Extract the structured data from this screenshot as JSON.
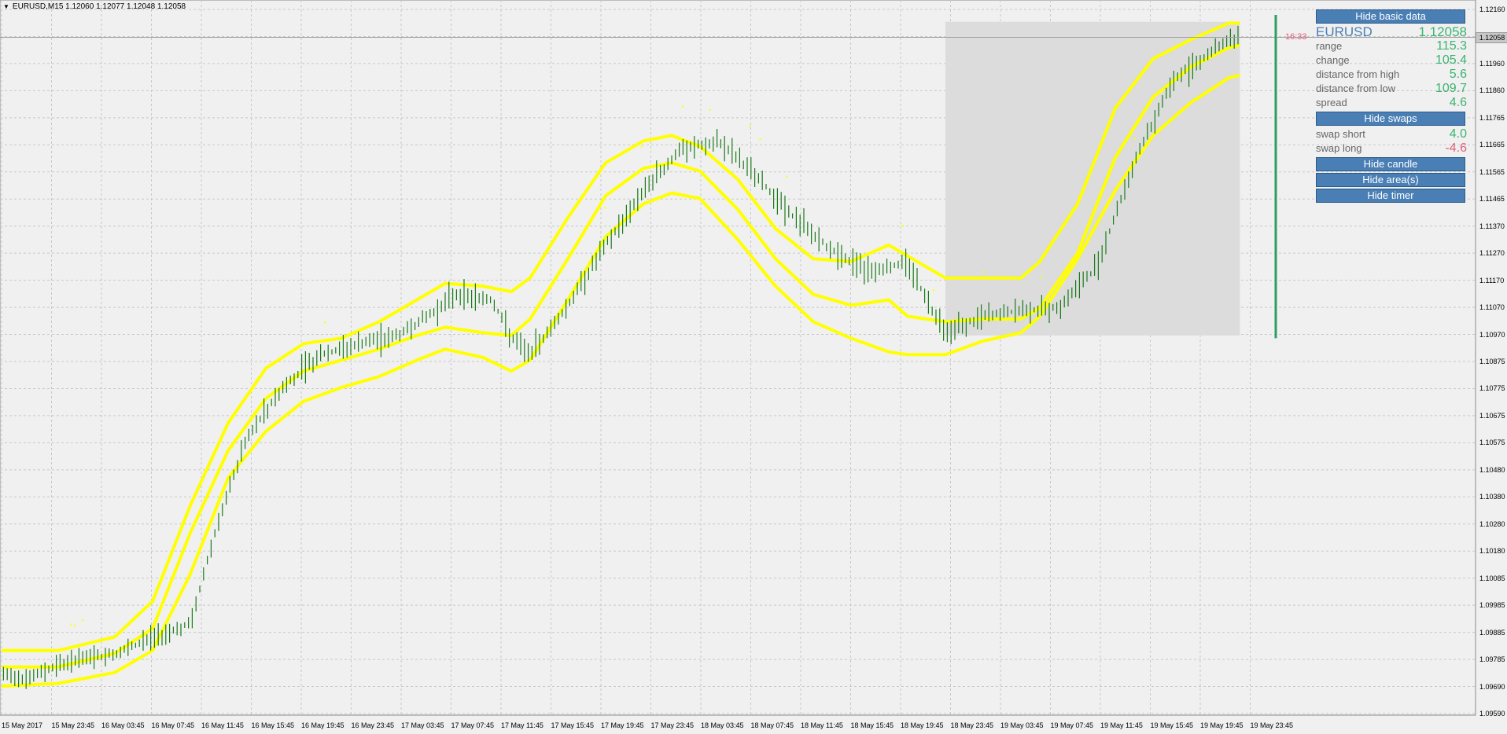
{
  "window": {
    "symbol_line": "EURUSD,M15  1.12060 1.12077 1.12048 1.12058"
  },
  "colors": {
    "background": "#f0f0f0",
    "bands": "#ffff00",
    "bars": "#1a7a1a",
    "shaded_area": "#dcdcdc",
    "grid": "#c8c8c8",
    "button": "#4a7fb5",
    "positive_value": "#3cb371",
    "negative_value": "#e0607a"
  },
  "current_price_flag": "1.12058",
  "timer": "16:33",
  "panel": {
    "hide_basic_data": "Hide basic data",
    "symbol": "EURUSD",
    "price": "1.12058",
    "stats": [
      {
        "label": "range",
        "value": "115.3"
      },
      {
        "label": "change",
        "value": "105.4"
      },
      {
        "label": "distance from high",
        "value": "5.6"
      },
      {
        "label": "distance from low",
        "value": "109.7"
      },
      {
        "label": "spread",
        "value": "4.6"
      }
    ],
    "hide_swaps": "Hide swaps",
    "swaps": [
      {
        "label": "swap short",
        "value": "4.0"
      },
      {
        "label": "swap long",
        "value": "-4.6"
      }
    ],
    "hide_candle": "Hide candle",
    "hide_areas": "Hide area(s)",
    "hide_timer": "Hide timer"
  },
  "chart_data": {
    "type": "ohlc",
    "y_ticks": [
      "1.12160",
      "1.12060",
      "1.11960",
      "1.11860",
      "1.11765",
      "1.11665",
      "1.11565",
      "1.11465",
      "1.11370",
      "1.11270",
      "1.11170",
      "1.11070",
      "1.10970",
      "1.10875",
      "1.10775",
      "1.10675",
      "1.10575",
      "1.10480",
      "1.10380",
      "1.10280",
      "1.10180",
      "1.10085",
      "1.09985",
      "1.09885",
      "1.09785",
      "1.09690",
      "1.09590"
    ],
    "x_ticks": [
      "15 May 2017",
      "15 May 23:45",
      "16 May 03:45",
      "16 May 07:45",
      "16 May 11:45",
      "16 May 15:45",
      "16 May 19:45",
      "16 May 23:45",
      "17 May 03:45",
      "17 May 07:45",
      "17 May 11:45",
      "17 May 15:45",
      "17 May 19:45",
      "17 May 23:45",
      "18 May 03:45",
      "18 May 07:45",
      "18 May 11:45",
      "18 May 15:45",
      "18 May 19:45",
      "18 May 23:45",
      "19 May 03:45",
      "19 May 07:45",
      "19 May 11:45",
      "19 May 15:45",
      "19 May 19:45",
      "19 May 23:45"
    ],
    "ylim": [
      1.0959,
      1.1216
    ],
    "price_path": [
      [
        0,
        1.0973
      ],
      [
        30,
        1.0972
      ],
      [
        60,
        1.0977
      ],
      [
        120,
        1.0981
      ],
      [
        200,
        1.0992
      ],
      [
        230,
        1.103
      ],
      [
        260,
        1.106
      ],
      [
        300,
        1.1079
      ],
      [
        340,
        1.109
      ],
      [
        380,
        1.1094
      ],
      [
        420,
        1.1097
      ],
      [
        460,
        1.1106
      ],
      [
        480,
        1.1112
      ],
      [
        520,
        1.111
      ],
      [
        540,
        1.1096
      ],
      [
        560,
        1.109
      ],
      [
        600,
        1.1108
      ],
      [
        640,
        1.113
      ],
      [
        680,
        1.115
      ],
      [
        720,
        1.1165
      ],
      [
        760,
        1.1168
      ],
      [
        800,
        1.1155
      ],
      [
        840,
        1.114
      ],
      [
        880,
        1.1128
      ],
      [
        920,
        1.112
      ],
      [
        960,
        1.1124
      ],
      [
        980,
        1.111
      ],
      [
        1000,
        1.1098
      ],
      [
        1040,
        1.1104
      ],
      [
        1080,
        1.1106
      ],
      [
        1120,
        1.1107
      ],
      [
        1160,
        1.1122
      ],
      [
        1200,
        1.116
      ],
      [
        1240,
        1.119
      ],
      [
        1280,
        1.12
      ],
      [
        1300,
        1.1205
      ],
      [
        1312,
        1.1206
      ]
    ],
    "bands": {
      "upper": [
        [
          0,
          1.0982
        ],
        [
          60,
          1.0982
        ],
        [
          120,
          1.0987
        ],
        [
          160,
          1.1
        ],
        [
          200,
          1.1035
        ],
        [
          240,
          1.1065
        ],
        [
          280,
          1.1085
        ],
        [
          320,
          1.1094
        ],
        [
          360,
          1.1096
        ],
        [
          400,
          1.1102
        ],
        [
          440,
          1.111
        ],
        [
          470,
          1.1116
        ],
        [
          510,
          1.1115
        ],
        [
          540,
          1.1113
        ],
        [
          560,
          1.1118
        ],
        [
          600,
          1.114
        ],
        [
          640,
          1.116
        ],
        [
          680,
          1.1168
        ],
        [
          710,
          1.117
        ],
        [
          740,
          1.1166
        ],
        [
          780,
          1.1154
        ],
        [
          820,
          1.1136
        ],
        [
          860,
          1.1125
        ],
        [
          900,
          1.1124
        ],
        [
          940,
          1.113
        ],
        [
          960,
          1.1126
        ],
        [
          1000,
          1.1118
        ],
        [
          1040,
          1.1118
        ],
        [
          1080,
          1.1118
        ],
        [
          1100,
          1.1124
        ],
        [
          1140,
          1.1145
        ],
        [
          1180,
          1.118
        ],
        [
          1220,
          1.1198
        ],
        [
          1260,
          1.1205
        ],
        [
          1300,
          1.1211
        ],
        [
          1312,
          1.1211
        ]
      ],
      "middle": [
        [
          0,
          1.0976
        ],
        [
          60,
          1.0976
        ],
        [
          120,
          1.0981
        ],
        [
          160,
          1.099
        ],
        [
          200,
          1.1025
        ],
        [
          240,
          1.1055
        ],
        [
          280,
          1.1074
        ],
        [
          320,
          1.1084
        ],
        [
          360,
          1.1088
        ],
        [
          400,
          1.1092
        ],
        [
          440,
          1.1097
        ],
        [
          470,
          1.11
        ],
        [
          510,
          1.1098
        ],
        [
          540,
          1.1097
        ],
        [
          560,
          1.1103
        ],
        [
          600,
          1.1125
        ],
        [
          640,
          1.1148
        ],
        [
          680,
          1.1158
        ],
        [
          710,
          1.116
        ],
        [
          740,
          1.1157
        ],
        [
          780,
          1.1143
        ],
        [
          820,
          1.1125
        ],
        [
          860,
          1.1112
        ],
        [
          900,
          1.1108
        ],
        [
          940,
          1.111
        ],
        [
          960,
          1.1104
        ],
        [
          1000,
          1.1102
        ],
        [
          1040,
          1.1103
        ],
        [
          1080,
          1.1103
        ],
        [
          1100,
          1.1107
        ],
        [
          1140,
          1.1127
        ],
        [
          1180,
          1.1162
        ],
        [
          1220,
          1.1184
        ],
        [
          1260,
          1.1195
        ],
        [
          1300,
          1.1202
        ],
        [
          1312,
          1.1203
        ]
      ],
      "lower": [
        [
          0,
          1.0969
        ],
        [
          60,
          1.097
        ],
        [
          120,
          1.0974
        ],
        [
          160,
          1.0982
        ],
        [
          200,
          1.101
        ],
        [
          240,
          1.1045
        ],
        [
          280,
          1.1062
        ],
        [
          320,
          1.1073
        ],
        [
          360,
          1.1078
        ],
        [
          400,
          1.1082
        ],
        [
          440,
          1.1088
        ],
        [
          470,
          1.1092
        ],
        [
          510,
          1.1089
        ],
        [
          540,
          1.1084
        ],
        [
          560,
          1.1088
        ],
        [
          600,
          1.111
        ],
        [
          640,
          1.1133
        ],
        [
          680,
          1.1145
        ],
        [
          710,
          1.1149
        ],
        [
          740,
          1.1147
        ],
        [
          780,
          1.1132
        ],
        [
          820,
          1.1115
        ],
        [
          860,
          1.1102
        ],
        [
          900,
          1.1096
        ],
        [
          940,
          1.1091
        ],
        [
          960,
          1.109
        ],
        [
          1000,
          1.109
        ],
        [
          1040,
          1.1095
        ],
        [
          1080,
          1.1098
        ],
        [
          1100,
          1.1104
        ],
        [
          1140,
          1.1125
        ],
        [
          1180,
          1.115
        ],
        [
          1220,
          1.117
        ],
        [
          1260,
          1.1182
        ],
        [
          1300,
          1.1191
        ],
        [
          1312,
          1.1192
        ]
      ]
    },
    "shaded_range": {
      "price_low": 1.1097,
      "price_high": 1.12115
    },
    "current_candle": {
      "low": 1.1096,
      "high": 1.1214
    }
  }
}
